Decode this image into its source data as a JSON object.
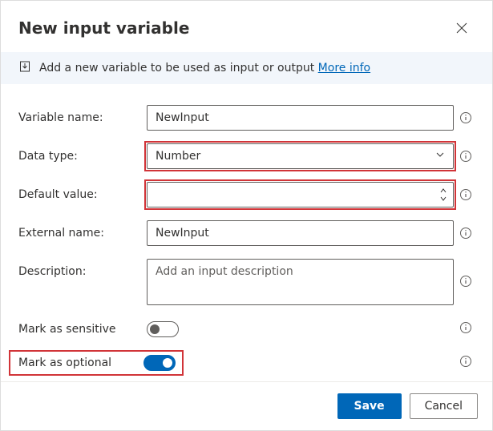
{
  "dialog": {
    "title": "New input variable"
  },
  "banner": {
    "text": "Add a new variable to be used as input or output",
    "link_text": "More info"
  },
  "labels": {
    "variable_name": "Variable name:",
    "data_type": "Data type:",
    "default_value": "Default value:",
    "external_name": "External name:",
    "description": "Description:",
    "mark_sensitive": "Mark as sensitive",
    "mark_optional": "Mark as optional"
  },
  "fields": {
    "variable_name": "NewInput",
    "data_type": "Number",
    "default_value": "",
    "external_name": "NewInput",
    "description": "",
    "description_placeholder": "Add an input description",
    "mark_sensitive_on": false,
    "mark_optional_on": true
  },
  "footer": {
    "save": "Save",
    "cancel": "Cancel"
  }
}
